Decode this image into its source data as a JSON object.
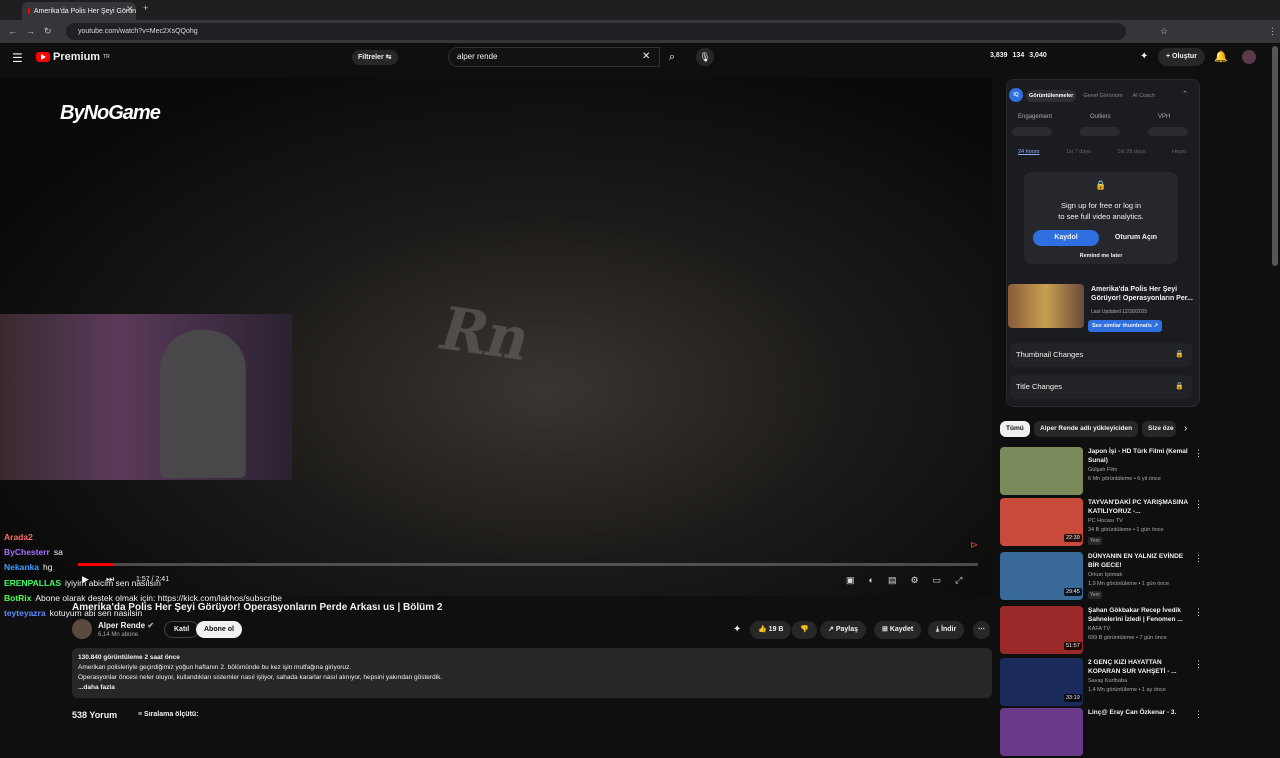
{
  "browser": {
    "tab_title": "Amerika'da Polis Her Şeyi Görün",
    "url": "youtube.com/watch?v=Mec2XsQQohg"
  },
  "header": {
    "logo": "Premium",
    "logo_sup": "TR",
    "filters": "Filtreler",
    "search_value": "alper rende",
    "stats": [
      "3,839",
      "134",
      "3,040"
    ],
    "create": "Oluştur"
  },
  "video": {
    "brand_watermark": "ByNoGame",
    "time": "1:57 / 2:41",
    "progress": 0.04,
    "title": "Amerika'da Polis Her Şeyi Görüyor! Operasyonların Perde Arkası us | Bölüm 2",
    "channel": "Alper Rende",
    "subscribers": "6,14 Mn abone",
    "join": "Katıl",
    "subscribe": "Abone ol",
    "likes": "19 B",
    "share": "Paylaş",
    "save": "Kaydet",
    "download": "İndir"
  },
  "chat": [
    {
      "name": "Arada2",
      "text": "",
      "color": "#ff6b6b"
    },
    {
      "name": "ByChesterr",
      "text": "sa",
      "color": "#a970ff"
    },
    {
      "name": "Nekanka",
      "text": "hg",
      "color": "#3ba0ff"
    },
    {
      "name": "ERENPALLAS",
      "text": "iyiyim abicim sen nasılsın",
      "color": "#3bff6b"
    },
    {
      "name": "BotRix",
      "text": "Abone olarak destek olmak için: https://kick.com/lakhos/subscribe",
      "color": "#4bff4b"
    },
    {
      "name": "teyteyazra",
      "text": "kotuyum abi sen nasilsin",
      "color": "#5a8cff"
    }
  ],
  "description": {
    "meta": "130.840 görüntüleme  2 saat önce",
    "line1": "Amerikan polisleriyle geçirdiğimiz yoğun haftanın 2. bölümünde bu kez işin mutfağına giriyoruz.",
    "line2": "Operasyonlar öncesi neler oluyor, kullandıkları sistemler nasıl işliyor, sahada kararlar nasıl alınıyor, hepsini yakından gösterdik.",
    "more": "...daha fazla"
  },
  "comments": {
    "count": "538 Yorum",
    "sort": "Sıralama ölçütü:"
  },
  "panel": {
    "tabs": [
      "Görüntülenmeler",
      "Genel Görünüm",
      "AI Coach"
    ],
    "metrics": [
      "Engagement",
      "Outliers",
      "VPH"
    ],
    "periods": [
      "24 hours",
      "1st 7 days",
      "1st 28 days",
      "Hepsi"
    ],
    "signup_line1": "Sign up for free or log in",
    "signup_line2": "to see full video analytics.",
    "kaydol": "Kaydol",
    "oturum": "Oturum Açın",
    "remind": "Remind me later",
    "thumb_title": "Amerika'da Polis Her Şeyi Görüyor! Operasyonların Per...",
    "last_updated": "Last Updated 12/30/2025",
    "similar": "See similar thumbnails",
    "thumbnail_changes": "Thumbnail Changes",
    "title_changes": "Title Changes"
  },
  "chips": [
    "Tümü",
    "Alper Rende adlı yükleyiciden",
    "Size öze"
  ],
  "recommended": [
    {
      "title": "Japon İşi - HD Türk Filmi (Kemal Sunal)",
      "channel": "Gülşah Film",
      "meta": "6 Mn görüntüleme • 6 yıl önce",
      "duration": "",
      "badge": "",
      "color": "#7a8a5a"
    },
    {
      "title": "TAYVAN'DAKİ PC YARIŞMASINA KATILIYORUZ -...",
      "channel": "PC Hocası TV",
      "meta": "34 B görüntüleme • 1 gün önce",
      "duration": "22:39",
      "badge": "Yeni",
      "color": "#c84a3a"
    },
    {
      "title": "DÜNYANIN EN YALNIZ EVİNDE BİR GECE!",
      "channel": "Orkun Işıtmak",
      "meta": "1,9 Mn görüntüleme • 1 gün önce",
      "duration": "29:45",
      "badge": "Yeni",
      "color": "#3a6a9a"
    },
    {
      "title": "Şahan Gökbakar Recep İvedik Sahnelerini İzledi | Fenomen ...",
      "channel": "KAFA TV",
      "meta": "699 B görüntüleme • 7 gün önce",
      "duration": "51:57",
      "badge": "",
      "color": "#9a2a2a"
    },
    {
      "title": "2 GENÇ KIZI HAYATTAN KOPARAN SUR VAHŞETİ - ...",
      "channel": "Savaş Kurtbaba",
      "meta": "1,4 Mn görüntüleme • 1 ay önce",
      "duration": "33:19",
      "badge": "",
      "color": "#1a2a5a"
    },
    {
      "title": "Linç@ Eray Can Özkenar - 3.",
      "channel": "",
      "meta": "",
      "duration": "",
      "badge": "",
      "color": "#6a3a8a"
    }
  ]
}
